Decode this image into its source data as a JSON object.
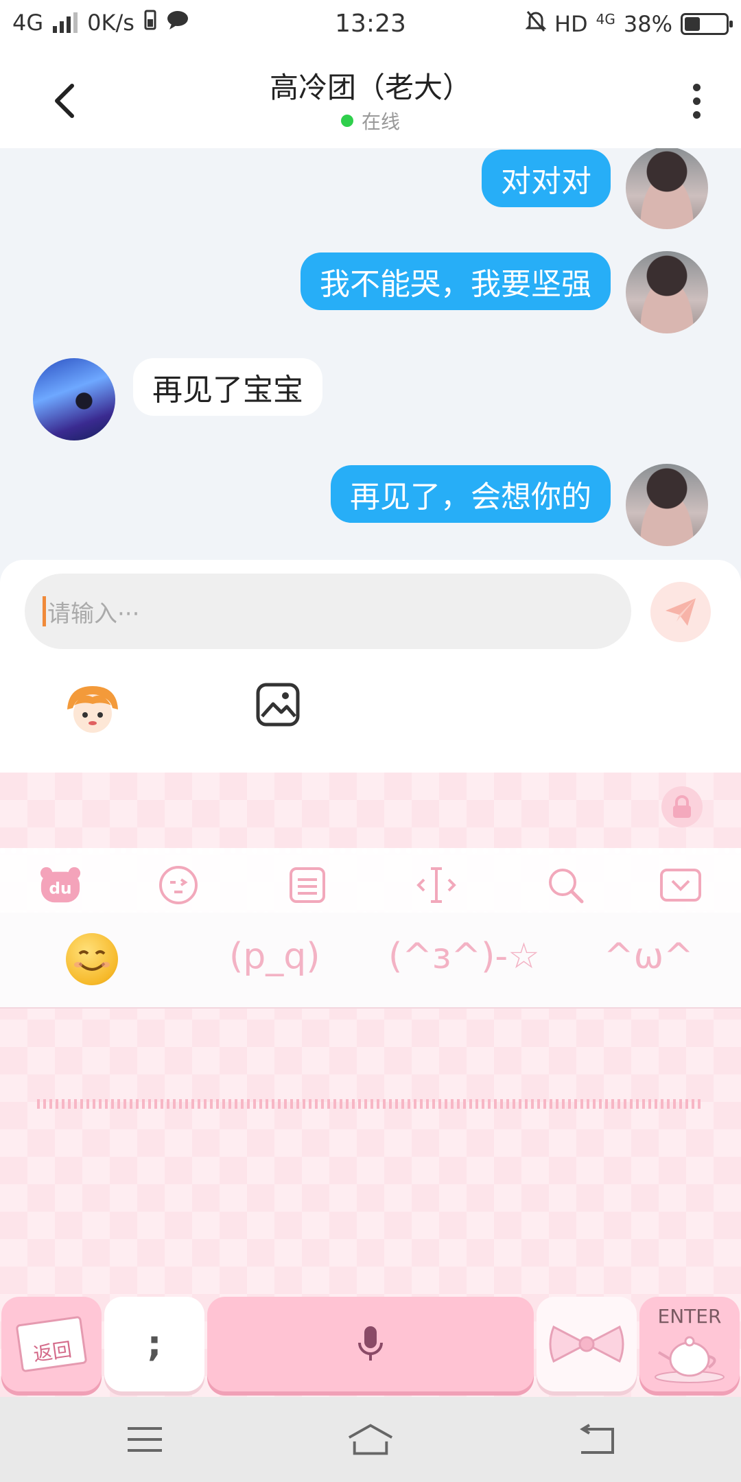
{
  "status_bar": {
    "network": "4G",
    "speed": "0K/s",
    "time": "13:23",
    "hd": "HD",
    "net_right": "4G",
    "battery": "38%",
    "battery_level": 0.38
  },
  "header": {
    "title": "高冷团（老大）",
    "status": "在线",
    "status_color": "#2fcf4c"
  },
  "messages": [
    {
      "side": "me",
      "text": "对对对"
    },
    {
      "side": "me",
      "text": "我不能哭，我要坚强"
    },
    {
      "side": "other",
      "text": "再见了宝宝"
    },
    {
      "side": "me",
      "text": "再见了，会想你的"
    }
  ],
  "input": {
    "placeholder": "请输入···"
  },
  "keyboard": {
    "candidates": [
      "(p_q)",
      "(^ɜ^)-☆",
      "^ω^"
    ],
    "toolbar_icons": [
      "du-logo-icon",
      "emoticon-icon",
      "keyboard-layout-icon",
      "cursor-icon",
      "search-icon",
      "collapse-icon"
    ],
    "enter_label": "ENTER",
    "back_label": "返回",
    "punct_label": ";"
  },
  "colors": {
    "accent_bubble": "#27aef7",
    "keyboard_pink": "#fde4ea"
  }
}
